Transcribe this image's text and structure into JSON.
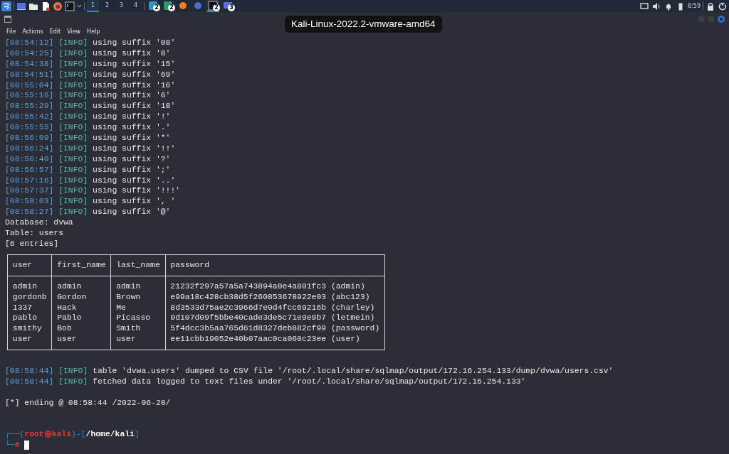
{
  "taskbar": {
    "workspaces": [
      {
        "label": "1",
        "selected": true
      },
      {
        "label": "2",
        "selected": false
      },
      {
        "label": "3",
        "selected": false
      },
      {
        "label": "4",
        "selected": false
      }
    ],
    "windows": [
      {
        "badge": "2",
        "selected": false
      },
      {
        "badge": "2",
        "selected": false
      },
      {
        "selected": false
      },
      {
        "selected": false
      },
      {
        "badge": "2",
        "selected": true
      },
      {
        "badge": "3",
        "selected": false
      }
    ],
    "clock": "8:59"
  },
  "vm_label": "Kali-Linux-2022.2-vmware-amd64",
  "menu": [
    "File",
    "Actions",
    "Edit",
    "View",
    "Help"
  ],
  "log": [
    {
      "time": "[08:54:12]",
      "level": "[INFO]",
      "message": "using suffix '08'"
    },
    {
      "time": "[08:54:25]",
      "level": "[INFO]",
      "message": "using suffix '8'"
    },
    {
      "time": "[08:54:38]",
      "level": "[INFO]",
      "message": "using suffix '15'"
    },
    {
      "time": "[08:54:51]",
      "level": "[INFO]",
      "message": "using suffix '69'"
    },
    {
      "time": "[08:55:04]",
      "level": "[INFO]",
      "message": "using suffix '16'"
    },
    {
      "time": "[08:55:16]",
      "level": "[INFO]",
      "message": "using suffix '6'"
    },
    {
      "time": "[08:55:29]",
      "level": "[INFO]",
      "message": "using suffix '18'"
    },
    {
      "time": "[08:55:42]",
      "level": "[INFO]",
      "message": "using suffix '!'"
    },
    {
      "time": "[08:55:55]",
      "level": "[INFO]",
      "message": "using suffix '.'"
    },
    {
      "time": "[08:56:09]",
      "level": "[INFO]",
      "message": "using suffix '*'"
    },
    {
      "time": "[08:56:24]",
      "level": "[INFO]",
      "message": "using suffix '!!'"
    },
    {
      "time": "[08:56:40]",
      "level": "[INFO]",
      "message": "using suffix '?'"
    },
    {
      "time": "[08:56:57]",
      "level": "[INFO]",
      "message": "using suffix ';'"
    },
    {
      "time": "[08:57:16]",
      "level": "[INFO]",
      "message": "using suffix '..'"
    },
    {
      "time": "[08:57:37]",
      "level": "[INFO]",
      "message": "using suffix '!!!'"
    },
    {
      "time": "[08:58:03]",
      "level": "[INFO]",
      "message": "using suffix ', '"
    },
    {
      "time": "[08:58:27]",
      "level": "[INFO]",
      "message": "using suffix '@'"
    }
  ],
  "summary": [
    "Database: dvwa",
    "Table: users",
    "[6 entries]"
  ],
  "table": {
    "columns": [
      "user",
      "first_name",
      "last_name",
      "password"
    ],
    "rows": [
      [
        "admin",
        "admin",
        "admin",
        "21232f297a57a5a743894a0e4a801fc3 (admin)"
      ],
      [
        "gordonb",
        "Gordon",
        "Brown",
        "e99a18c428cb38d5f260853678922e03 (abc123)"
      ],
      [
        "1337",
        "Hack",
        "Me",
        "8d3533d75ae2c3966d7e0d4fcc69216b (charley)"
      ],
      [
        "pablo",
        "Pablo",
        "Picasso",
        "0d107d09f5bbe40cade3de5c71e9e9b7 (letmein)"
      ],
      [
        "smithy",
        "Bob",
        "Smith",
        "5f4dcc3b5aa765d61d8327deb882cf99 (password)"
      ],
      [
        "user",
        "user",
        "user",
        "ee11cbb19052e40b07aac0ca060c23ee (user)"
      ]
    ]
  },
  "log_after": [
    {
      "time": "[08:58:44]",
      "level": "[INFO]",
      "message": "table 'dvwa.users' dumped to CSV file '/root/.local/share/sqlmap/output/172.16.254.133/dump/dvwa/users.csv'"
    },
    {
      "time": "[08:58:44]",
      "level": "[INFO]",
      "message": "fetched data logged to text files under '/root/.local/share/sqlmap/output/172.16.254.133'"
    }
  ],
  "ending": "[*] ending @ 08:58:44 /2022-06-20/",
  "prompt": [
    [
      {
        "kind": "frame",
        "text": "┌──("
      },
      {
        "kind": "user",
        "text": "root㉿kali"
      },
      {
        "kind": "frame",
        "text": ")-["
      },
      {
        "kind": "path",
        "text": "/home/kali"
      },
      {
        "kind": "frame",
        "text": "]"
      }
    ],
    [
      {
        "kind": "frame",
        "text": "└─"
      },
      {
        "kind": "user",
        "text": "#"
      }
    ]
  ]
}
